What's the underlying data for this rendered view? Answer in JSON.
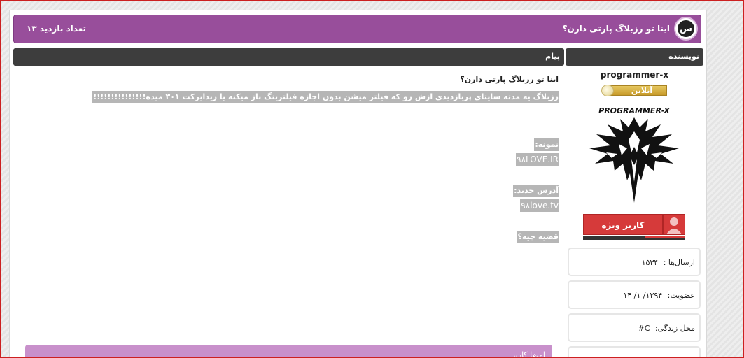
{
  "header": {
    "logo_glyph": "س",
    "thread_title": "اینا تو رزبلاگ پارتی دارن؟",
    "views_label": "تعداد بازدید ۱۳"
  },
  "columns": {
    "message": "پیام",
    "author": "نویسنده"
  },
  "post": {
    "title": "اینا تو رزبلاگ پارتی دارن؟",
    "body_line": "رزبلاگ یه مدته سایتای پربازدیدی ازش رو که فیلتر میشن بدون اجازه فیلترینگ باز میکنه یا ریدایرکت ۳۰۱ میده!!!!!!!!!!!!!!!",
    "example_label": "نمونه:",
    "example_value": "۹۸LOVE.IR",
    "new_address_label": "آدرس جدید:",
    "new_address_value": "۹۸love.tv",
    "question": "قضیه چیه؟"
  },
  "signature": {
    "label": "امضا کاربر"
  },
  "author": {
    "username": "programmer-x",
    "online_status": "آنلاین",
    "avatar_caption": "PROGRAMMER-X",
    "badge_label": "کاربر ویژه",
    "posts_label": "ارسال‌ها :",
    "posts_value": "۱۵۳۴",
    "joined_label": "عضویت:",
    "joined_value": "۱۳۹۴/ ۱/ ۱۴",
    "location_label": "محل زندگی:",
    "location_value": "C#"
  },
  "colors": {
    "header_purple": "#984e9b",
    "column_header_dark": "#3d3d3d",
    "highlight_gray": "#b6b6b6",
    "badge_red": "#d63a3a",
    "online_gold": "#d4a93a"
  }
}
